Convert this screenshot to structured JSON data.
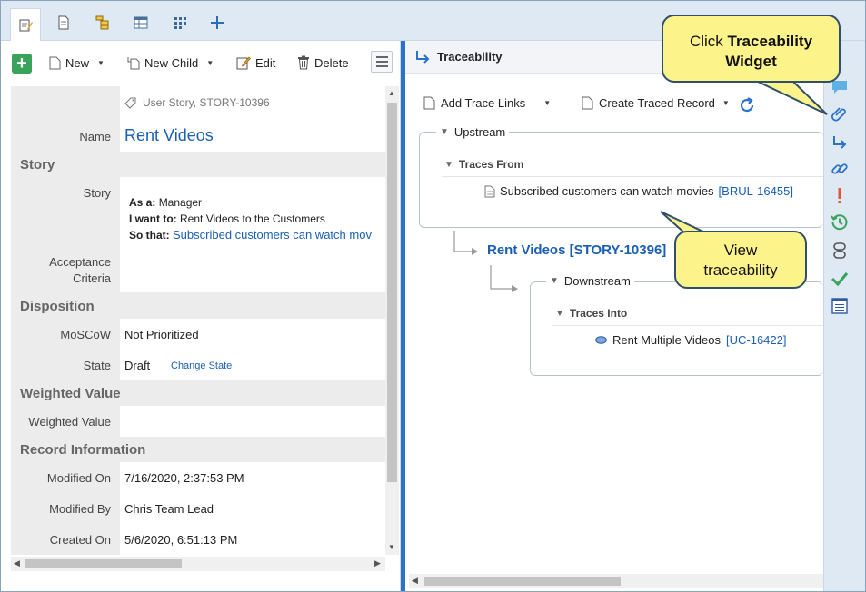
{
  "tabs": [
    {
      "icon": "edit-record-icon"
    },
    {
      "icon": "document-icon"
    },
    {
      "icon": "tree-icon"
    },
    {
      "icon": "table-icon"
    },
    {
      "icon": "grid-icon"
    },
    {
      "icon": "plus-icon"
    }
  ],
  "toolbar": {
    "new_label": "New",
    "new_child_label": "New Child",
    "edit_label": "Edit",
    "delete_label": "Delete"
  },
  "record": {
    "type_label": "User Story, STORY-10396",
    "name_label": "Name",
    "name_value": "Rent Videos",
    "sections": {
      "story": "Story",
      "disposition": "Disposition",
      "weighted_value": "Weighted Value",
      "record_information": "Record Information"
    },
    "story": {
      "label": "Story",
      "as_a_key": "As a:",
      "as_a_value": "Manager",
      "i_want_key": "I want to:",
      "i_want_value": "Rent Videos to the Customers",
      "so_that_key": "So that:",
      "so_that_value": "Subscribed customers can watch mov"
    },
    "acceptance_label_1": "Acceptance",
    "acceptance_label_2": "Criteria",
    "moscow_label": "MoSCoW",
    "moscow_value": "Not Prioritized",
    "state_label": "State",
    "state_value": "Draft",
    "change_state": "Change State",
    "weighted_value_label": "Weighted Value",
    "modified_on_label": "Modified On",
    "modified_on_value": "7/16/2020, 2:37:53 PM",
    "modified_by_label": "Modified By",
    "modified_by_value": "Chris Team Lead",
    "created_on_label": "Created On",
    "created_on_value": "5/6/2020, 6:51:13 PM"
  },
  "traceability": {
    "title": "Traceability",
    "add_trace_links": "Add Trace Links",
    "create_traced_record": "Create Traced Record",
    "upstream": "Upstream",
    "traces_from": "Traces From",
    "upstream_item_text": "Subscribed customers can watch movies",
    "upstream_item_id": "[BRUL-16455]",
    "current_record": "Rent Videos [STORY-10396]",
    "downstream": "Downstream",
    "traces_into": "Traces Into",
    "downstream_item_text": "Rent Multiple Videos",
    "downstream_item_id": "[UC-16422]"
  },
  "rail_icons": [
    "comment-icon",
    "attachment-icon",
    "trace-icon",
    "link-icon",
    "alert-icon",
    "history-icon",
    "sync-icon",
    "check-icon",
    "list-icon"
  ],
  "callouts": {
    "widget_prefix": "Click ",
    "widget_bold_line1": "Traceability",
    "widget_bold_line2": "Widget",
    "view_line1": "View",
    "view_line2": "traceability"
  },
  "colors": {
    "accent_blue": "#2b73c8",
    "link_blue": "#1a5fb4",
    "add_green": "#3aa35b",
    "callout_yellow": "#fdf38b",
    "alert_red": "#e2533c",
    "check_green": "#3aa35b"
  }
}
